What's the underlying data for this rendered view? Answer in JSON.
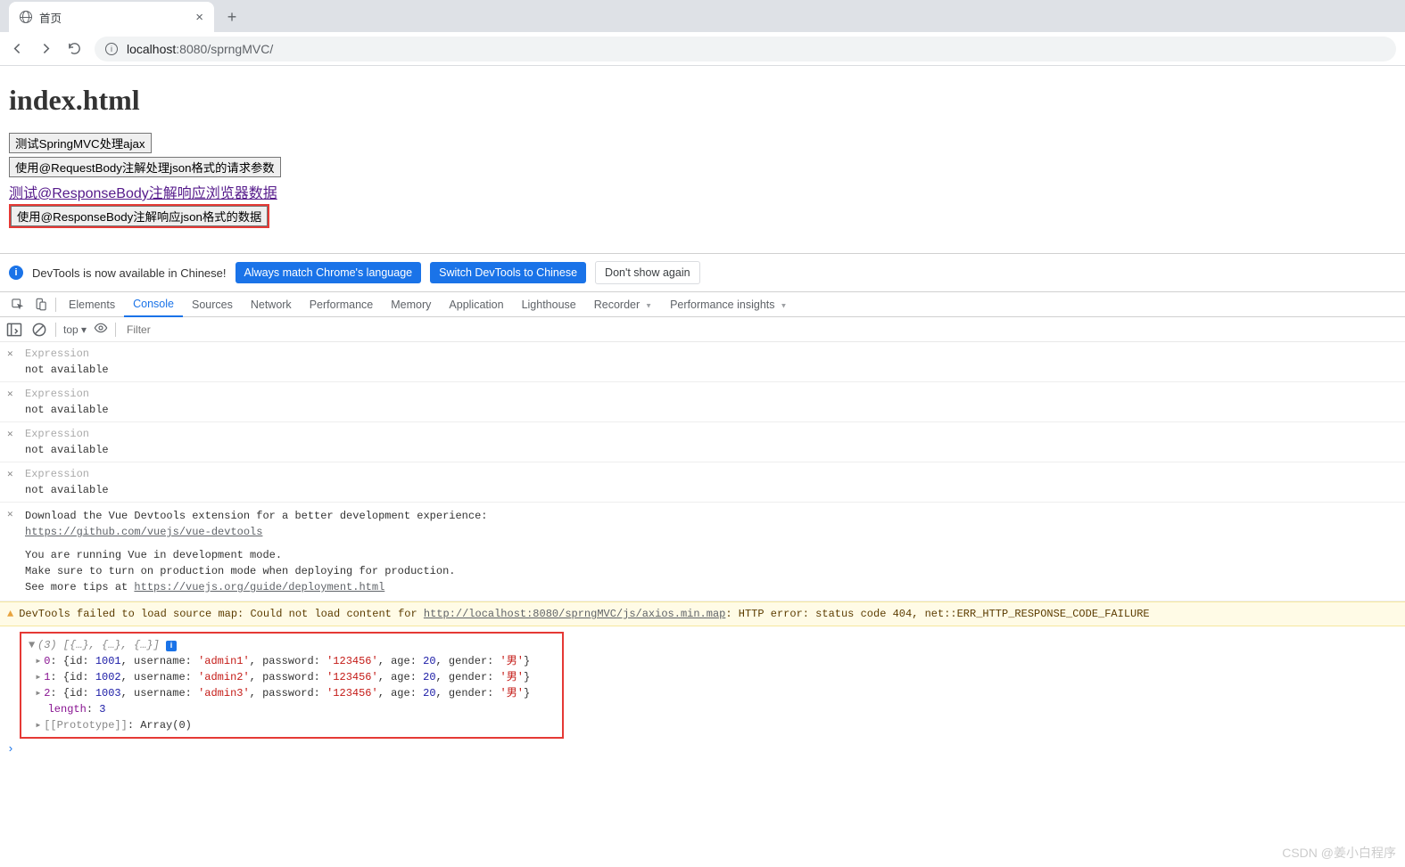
{
  "tab_title": "首页",
  "url_host": "localhost",
  "url_port": ":8080",
  "url_path": "/sprngMVC/",
  "page": {
    "heading": "index.html",
    "btn1": "测试SpringMVC处理ajax",
    "btn2": "使用@RequestBody注解处理json格式的请求参数",
    "link1": "测试@ResponseBody注解响应浏览器数据",
    "btn3": "使用@ResponseBody注解响应json格式的数据"
  },
  "dt_infobar": {
    "text": "DevTools is now available in Chinese!",
    "btn1": "Always match Chrome's language",
    "btn2": "Switch DevTools to Chinese",
    "btn3": "Don't show again"
  },
  "dt_tabs": [
    "Elements",
    "Console",
    "Sources",
    "Network",
    "Performance",
    "Memory",
    "Application",
    "Lighthouse",
    "Recorder",
    "Performance insights"
  ],
  "c_toolbar": {
    "scope": "top ▾",
    "filter_placeholder": "Filter"
  },
  "exprs": [
    {
      "label": "Expression",
      "value": "not available"
    },
    {
      "label": "Expression",
      "value": "not available"
    },
    {
      "label": "Expression",
      "value": "not available"
    },
    {
      "label": "Expression",
      "value": "not available"
    }
  ],
  "msg1_line1": "Download the Vue Devtools extension for a better development experience:",
  "msg1_link": "https://github.com/vuejs/vue-devtools",
  "msg2_line1": "You are running Vue in development mode.",
  "msg2_line2": "Make sure to turn on production mode when deploying for production.",
  "msg2_line3": "See more tips at ",
  "msg2_link": "https://vuejs.org/guide/deployment.html",
  "warn_pre": "DevTools failed to load source map: Could not load content for ",
  "warn_link": "http://localhost:8080/sprngMVC/js/axios.min.map",
  "warn_post": ": HTTP error: status code 404, net::ERR_HTTP_RESPONSE_CODE_FAILURE",
  "array_summary": "(3) [{…}, {…}, {…}]",
  "array": [
    {
      "id": 1001,
      "username": "admin1",
      "password": "123456",
      "age": 20,
      "gender": "男"
    },
    {
      "id": 1002,
      "username": "admin2",
      "password": "123456",
      "age": 20,
      "gender": "男"
    },
    {
      "id": 1003,
      "username": "admin3",
      "password": "123456",
      "age": 20,
      "gender": "男"
    }
  ],
  "array_length_label": "length",
  "array_length": "3",
  "proto_label": "[[Prototype]]",
  "proto_value": "Array(0)",
  "watermark": "CSDN @姜小白程序"
}
